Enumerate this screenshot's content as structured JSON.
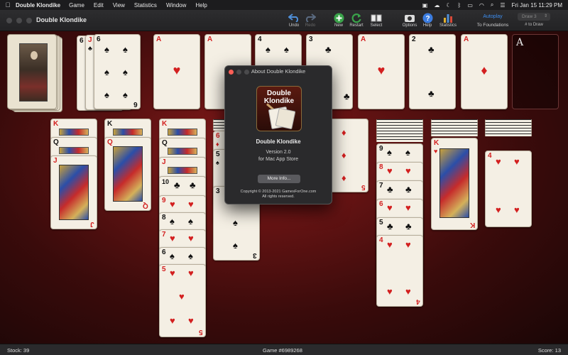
{
  "menubar": {
    "apple": "",
    "app_name": "Double Klondike",
    "items": [
      "Game",
      "Edit",
      "View",
      "Statistics",
      "Window",
      "Help"
    ],
    "clock": "Fri Jan 15  11:29 PM"
  },
  "window": {
    "title": "Double Klondike"
  },
  "toolbar": {
    "undo": "Undo",
    "redo": "Redo",
    "new": "New",
    "restart": "Restart",
    "select": "Select",
    "options": "Options",
    "help": "Help",
    "statistics": "Statistics",
    "autoplay": "Autoplay",
    "to_foundations": "To Foundations",
    "draw_value": "Draw 3",
    "draw_label": "# to Draw"
  },
  "foundation_empty": "A",
  "cards": {
    "waste": [
      {
        "rank": "6",
        "suit": "♠",
        "color": "blk"
      },
      {
        "rank": "J",
        "suit": "♣",
        "color": "blk"
      },
      {
        "rank": "6",
        "suit": "♠",
        "color": "blk"
      }
    ],
    "foundations": [
      {
        "rank": "A",
        "suit": "♥",
        "color": "red"
      },
      {
        "rank": "A",
        "suit": "♦",
        "color": "red"
      },
      {
        "rank": "4",
        "suit": "♠",
        "color": "blk"
      },
      {
        "rank": "3",
        "suit": "♣",
        "color": "blk"
      },
      {
        "rank": "A",
        "suit": "♥",
        "color": "red"
      },
      {
        "rank": "2",
        "suit": "♣",
        "color": "blk"
      },
      {
        "rank": "A",
        "suit": "♦",
        "color": "red"
      }
    ],
    "col1": [
      {
        "rank": "K",
        "suit": "♥",
        "color": "red"
      },
      {
        "rank": "Q",
        "suit": "♣",
        "color": "blk"
      },
      {
        "rank": "J",
        "suit": "♦",
        "color": "red"
      }
    ],
    "col2": [
      {
        "rank": "K",
        "suit": "♣",
        "color": "blk"
      },
      {
        "rank": "Q",
        "suit": "♦",
        "color": "red"
      }
    ],
    "col3": [
      {
        "rank": "K",
        "suit": "♦",
        "color": "red"
      },
      {
        "rank": "Q",
        "suit": "♠",
        "color": "blk"
      },
      {
        "rank": "J",
        "suit": "♥",
        "color": "red"
      },
      {
        "rank": "10",
        "suit": "♣",
        "color": "blk"
      },
      {
        "rank": "9",
        "suit": "♥",
        "color": "red"
      },
      {
        "rank": "8",
        "suit": "♠",
        "color": "blk"
      },
      {
        "rank": "7",
        "suit": "♥",
        "color": "red"
      },
      {
        "rank": "6",
        "suit": "♠",
        "color": "blk"
      },
      {
        "rank": "5",
        "suit": "♥",
        "color": "red"
      }
    ],
    "col4": [
      {
        "rank": "6",
        "suit": "♦",
        "color": "red"
      },
      {
        "rank": "5",
        "suit": "♠",
        "color": "blk"
      },
      {
        "rank": "3",
        "suit": "♠",
        "color": "blk"
      }
    ],
    "col5": [
      {
        "rank": "5",
        "suit": "♦",
        "color": "red"
      }
    ],
    "col6": [
      {
        "rank": "9",
        "suit": "♠",
        "color": "blk"
      },
      {
        "rank": "8",
        "suit": "♥",
        "color": "red"
      },
      {
        "rank": "7",
        "suit": "♣",
        "color": "blk"
      },
      {
        "rank": "6",
        "suit": "♥",
        "color": "red"
      },
      {
        "rank": "5",
        "suit": "♣",
        "color": "blk"
      },
      {
        "rank": "4",
        "suit": "♥",
        "color": "red"
      }
    ],
    "col7": [
      {
        "rank": "K",
        "suit": "♥",
        "color": "red"
      }
    ],
    "col8": [
      {
        "rank": "4",
        "suit": "♥",
        "color": "red"
      }
    ]
  },
  "about": {
    "title": "About Double Klondike",
    "logo_line1": "Double",
    "logo_line2": "Klondike",
    "name": "Double Klondike",
    "version": "Version 2.0",
    "store": "for Mac App Store",
    "more_info": "More Info...",
    "copyright": "Copyright © 2013-2021 GamesForOne.com",
    "rights": "All rights reserved."
  },
  "status": {
    "stock": "Stock: 39",
    "game": "Game #6989268",
    "score": "Score: 13"
  },
  "colors": {
    "accent": "#3d8ef0",
    "felt": "#7a1616",
    "card": "#f4efe4"
  }
}
